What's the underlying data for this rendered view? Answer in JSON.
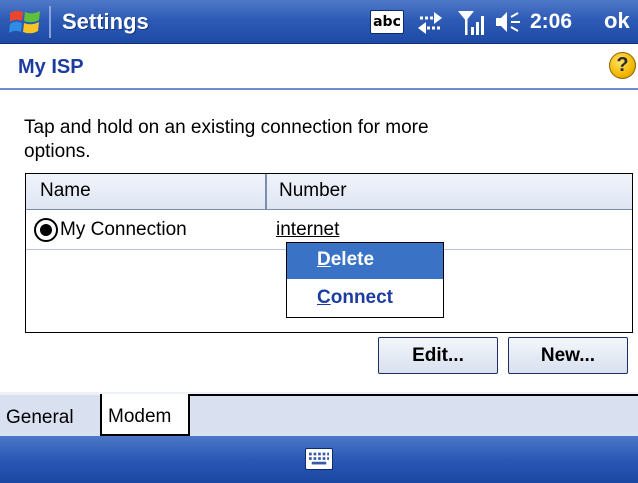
{
  "titlebar": {
    "app_title": "Settings",
    "input_indicator": "abc",
    "clock": "2:06",
    "ok_label": "ok"
  },
  "page": {
    "title": "My ISP",
    "help_glyph": "?",
    "instructions": "Tap and hold on an existing connection for more options."
  },
  "list": {
    "columns": [
      "Name",
      "Number"
    ],
    "rows": [
      {
        "name": "My Connection",
        "number": "internet",
        "selected": true
      }
    ]
  },
  "context_menu": {
    "items": [
      "Delete",
      "Connect"
    ],
    "highlighted": "Delete"
  },
  "buttons": {
    "edit_label": "Edit...",
    "new_label": "New..."
  },
  "tabs": [
    "General",
    "Modem"
  ],
  "active_tab": "Modem",
  "icons": {
    "start": "windows-flag-icon",
    "connectivity": "sync-arrows-icon",
    "signal": "signal-strength-icon",
    "volume": "speaker-icon",
    "help": "help-icon",
    "keyboard": "keyboard-icon"
  },
  "colors": {
    "titlebar": "#2e5bb6",
    "accent_text": "#1d3ca0",
    "menu_highlight": "#3a73c6",
    "help_icon": "#f2b800"
  }
}
